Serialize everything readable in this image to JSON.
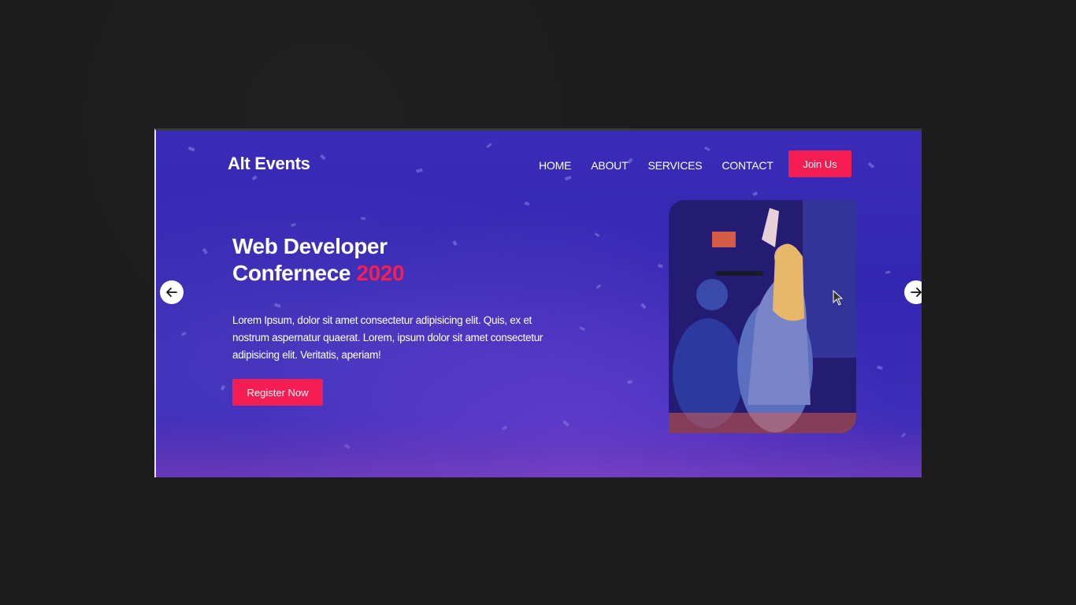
{
  "site": {
    "logo": "Alt Events"
  },
  "nav": {
    "items": [
      {
        "label": "HOME"
      },
      {
        "label": "ABOUT"
      },
      {
        "label": "SERVICES"
      },
      {
        "label": "CONTACT"
      }
    ],
    "cta_label": "Join Us"
  },
  "hero": {
    "title_line1": "Web Developer",
    "title_line2_prefix": "Confernece ",
    "title_line2_accent": "2020",
    "description": "Lorem Ipsum, dolor sit amet consectetur adipisicing elit. Quis, ex et nostrum aspernatur quaerat. Lorem, ipsum dolor sit amet consectetur adipisicing elit. Veritatis, aperiam!",
    "button_label": "Register Now"
  },
  "slider": {
    "prev_icon": "arrow-left-icon",
    "next_icon": "arrow-right-icon"
  },
  "colors": {
    "accent": "#f51d52",
    "hero_bg": "#3326b0",
    "page_bg": "#1b1b1b"
  }
}
